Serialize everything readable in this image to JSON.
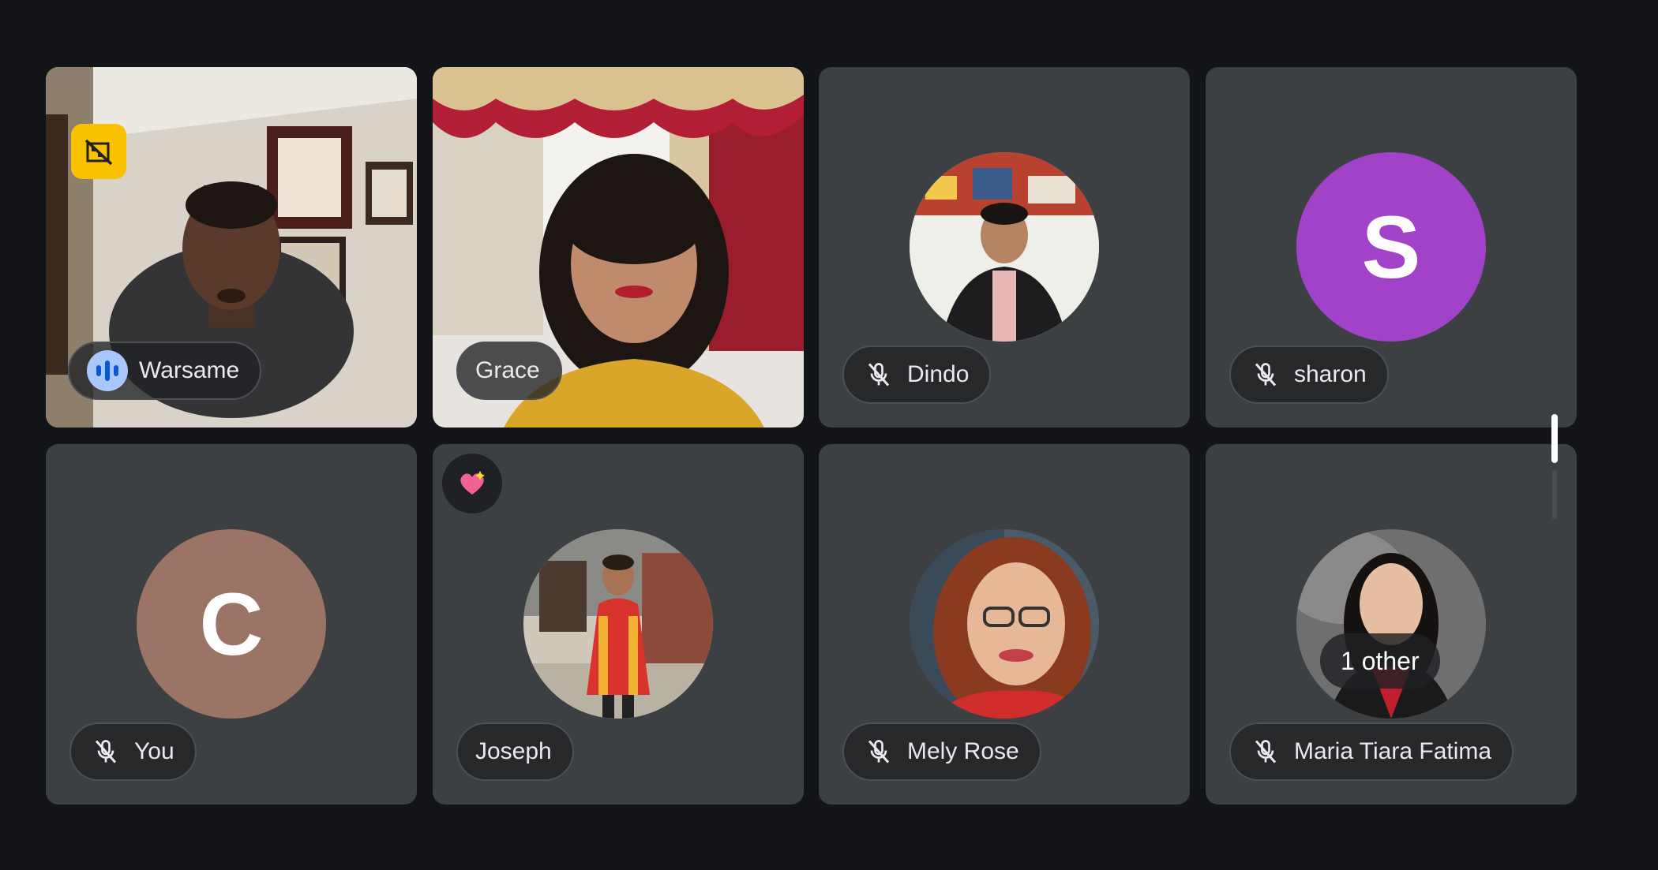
{
  "participants": [
    {
      "name": "Warsame",
      "status": "speaking",
      "type": "video"
    },
    {
      "name": "Grace",
      "status": "none",
      "type": "video"
    },
    {
      "name": "Dindo",
      "status": "muted",
      "type": "photo"
    },
    {
      "name": "sharon",
      "status": "muted",
      "type": "letter",
      "initial": "S",
      "color": "#a142c9"
    },
    {
      "name": "You",
      "status": "muted",
      "type": "letter",
      "initial": "C",
      "color": "#9c7466"
    },
    {
      "name": "Joseph",
      "status": "none",
      "type": "photo",
      "reaction": "heart"
    },
    {
      "name": "Mely Rose",
      "status": "muted",
      "type": "photo"
    },
    {
      "name": "Maria Tiara Fatima",
      "status": "muted",
      "type": "photo",
      "overlay": "1 other"
    }
  ],
  "icons": {
    "muted": "mic-off-icon",
    "speaking": "audio-level-icon",
    "framing": "no-framing-icon",
    "reaction": "sparkling-heart-icon"
  },
  "colors": {
    "page_bg": "#131417",
    "tile_bg": "#3c4043",
    "active_border": "#1f4a8c"
  }
}
